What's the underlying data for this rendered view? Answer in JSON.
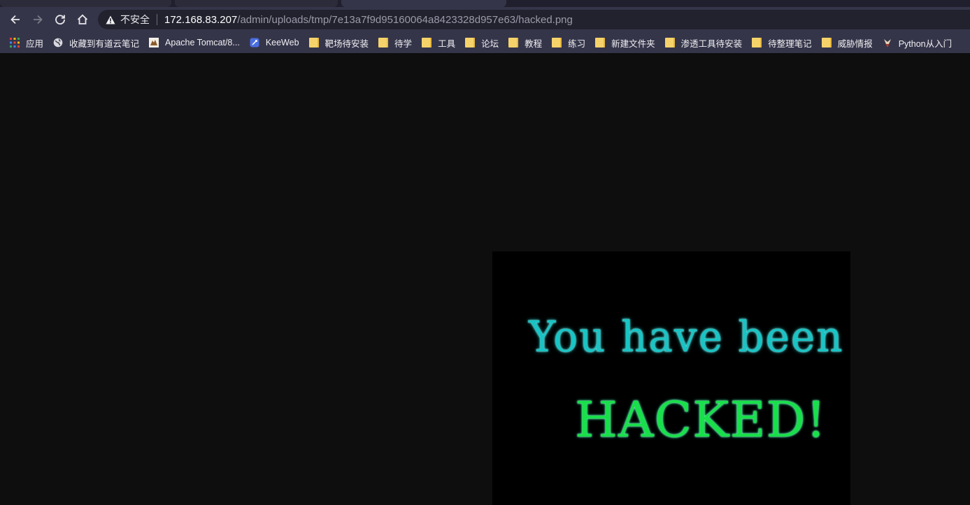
{
  "browser": {
    "security_label": "不安全",
    "url_host": "172.168.83.207",
    "url_path": "/admin/uploads/tmp/7e13a7f9d95160064a8423328d957e63/hacked.png"
  },
  "bookmarks": [
    {
      "label": "应用",
      "icon": "apps-grid-icon"
    },
    {
      "label": "收藏到有道云笔记",
      "icon": "globe-icon"
    },
    {
      "label": "Apache Tomcat/8...",
      "icon": "tomcat-icon"
    },
    {
      "label": "KeeWeb",
      "icon": "keeweb-icon"
    },
    {
      "label": "靶场待安装",
      "icon": "folder-icon"
    },
    {
      "label": "待学",
      "icon": "folder-icon"
    },
    {
      "label": "工具",
      "icon": "folder-icon"
    },
    {
      "label": "论坛",
      "icon": "folder-icon"
    },
    {
      "label": "教程",
      "icon": "folder-icon"
    },
    {
      "label": "练习",
      "icon": "folder-icon"
    },
    {
      "label": "新建文件夹",
      "icon": "folder-icon"
    },
    {
      "label": "渗透工具待安装",
      "icon": "folder-icon"
    },
    {
      "label": "待整理笔记",
      "icon": "folder-icon"
    },
    {
      "label": "威胁情报",
      "icon": "folder-icon"
    },
    {
      "label": "Python从入门",
      "icon": "python-site-icon"
    }
  ],
  "image": {
    "line1": "You have been",
    "line2": "HACKED!"
  },
  "colors": {
    "toolbar": "#35354a",
    "page_background": "#0e0e0e",
    "cyan_text": "#19c4c4",
    "green_text": "#18e04a"
  }
}
